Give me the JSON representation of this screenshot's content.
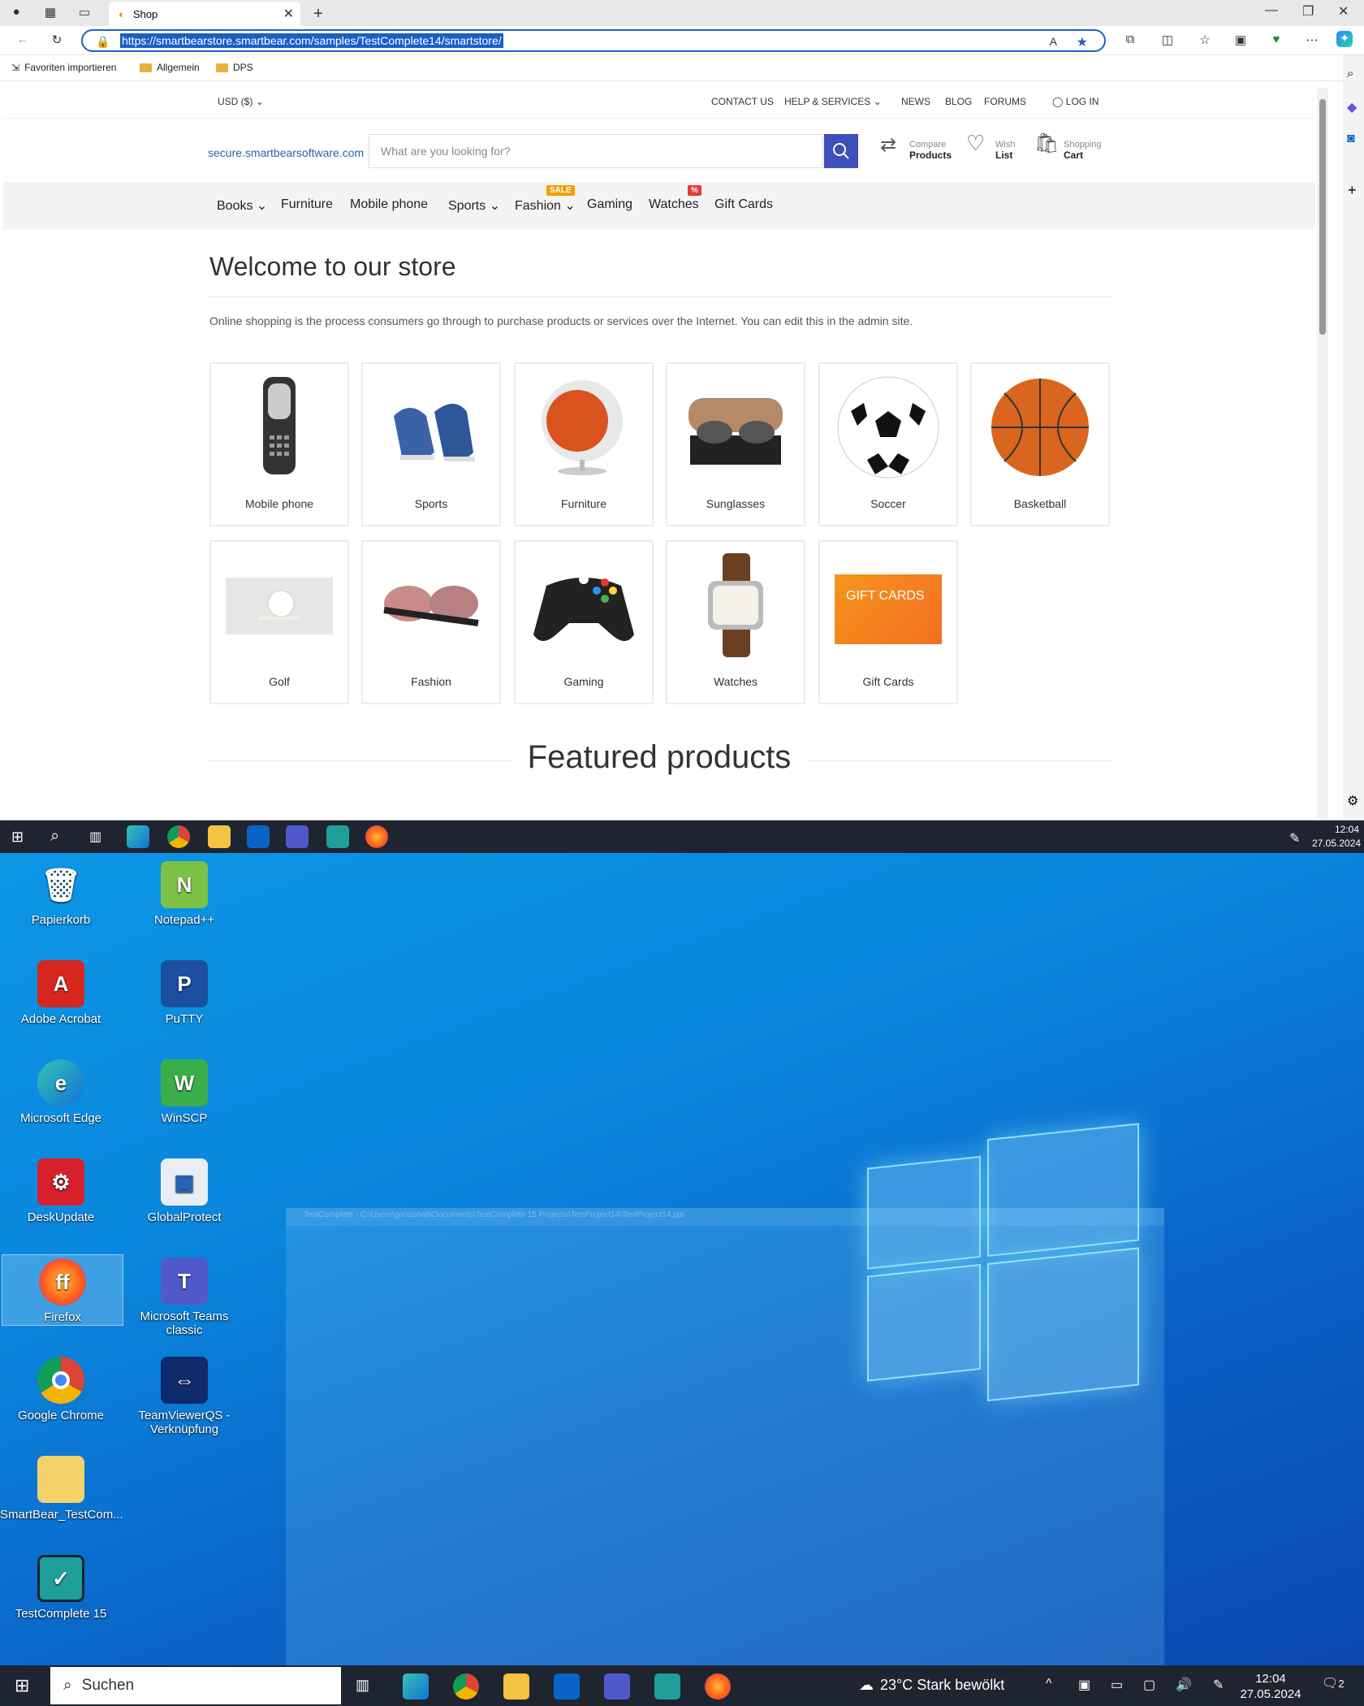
{
  "browser": {
    "tab_title": "Shop",
    "url": "https://smartbearstore.smartbear.com/samples/TestComplete14/smartstore/",
    "favorites": [
      "Favoriten importieren",
      "Allgemein",
      "DPS"
    ]
  },
  "store": {
    "currency": "USD ($)",
    "top_links": {
      "contact": "CONTACT US",
      "help": "HELP & SERVICES",
      "news": "NEWS",
      "blog": "BLOG",
      "forums": "FORUMS",
      "login": "LOG IN"
    },
    "brand_text": "secure.smartbearsoftware.com",
    "search_placeholder": "What are you looking for?",
    "header_links": [
      {
        "small": "Compare",
        "bold": "Products"
      },
      {
        "small": "Wish",
        "bold": "List"
      },
      {
        "small": "Shopping",
        "bold": "Cart"
      }
    ],
    "nav": [
      "Books",
      "Furniture",
      "Mobile phone",
      "Sports",
      "Fashion",
      "Gaming",
      "Watches",
      "Gift Cards"
    ],
    "sale_badge": "SALE",
    "percent_badge": "%",
    "welcome_title": "Welcome to our store",
    "intro": "Online shopping is the process consumers go through to purchase products or services over the Internet. You can edit this in the admin site.",
    "categories": [
      "Mobile phone",
      "Sports",
      "Furniture",
      "Sunglasses",
      "Soccer",
      "Basketball",
      "Golf",
      "Fashion",
      "Gaming",
      "Watches",
      "Gift Cards"
    ],
    "gift_card_text": "GIFT CARDS",
    "featured_title": "Featured products"
  },
  "desktop_icons": [
    "Papierkorb",
    "Notepad++",
    "Adobe Acrobat",
    "PuTTY",
    "Microsoft Edge",
    "WinSCP",
    "DeskUpdate",
    "GlobalProtect",
    "Firefox",
    "Microsoft Teams classic",
    "Google Chrome",
    "TeamViewerQS - Verknüpfung",
    "SmartBear_TestCom...",
    "TestComplete 15"
  ],
  "ghost_window_title": "TestComplete - C:\\Users\\gonzenab\\Documents\\TestComplete 15 Projects\\TestProject14\\TestProject14.pjs",
  "taskbar_top": {
    "time": "12:04",
    "date": "27.05.2024"
  },
  "taskbar_bottom": {
    "search": "Suchen",
    "weather": "23°C  Stark bewölkt",
    "time": "12:04",
    "date": "27.05.2024",
    "notifications": "2"
  },
  "colors": {
    "accent": "#3d4fb8",
    "sale": "#f0a000",
    "percent": "#e53935",
    "brand": "#2563a8"
  }
}
